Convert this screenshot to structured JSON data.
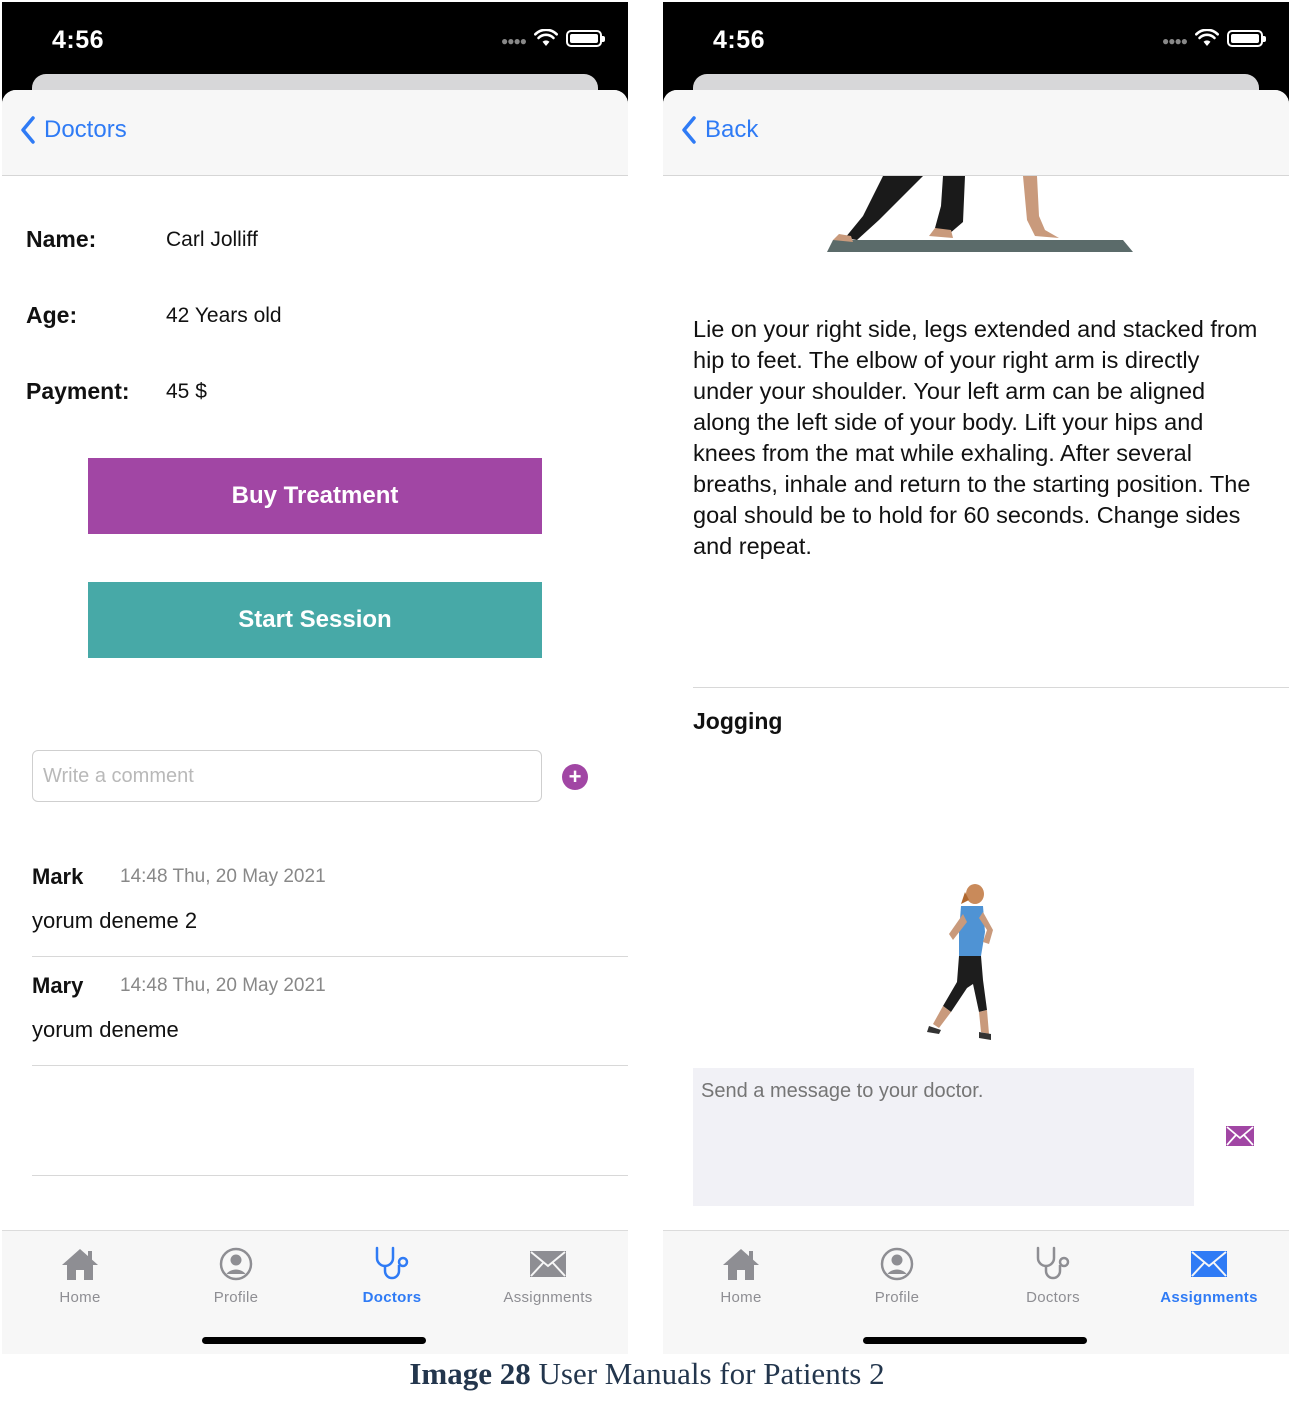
{
  "left_screen": {
    "status_time": "4:56",
    "nav_back_label": "Doctors",
    "fields": [
      {
        "label": "Name:",
        "value": "Carl Jolliff"
      },
      {
        "label": "Age:",
        "value": "42 Years old"
      },
      {
        "label": "Payment:",
        "value": "45 $"
      }
    ],
    "buy_button_label": "Buy Treatment",
    "start_button_label": "Start Session",
    "comment_placeholder": "Write a comment",
    "comments": [
      {
        "author": "Mark",
        "time": "14:48 Thu, 20 May 2021",
        "text": "yorum deneme 2"
      },
      {
        "author": "Mary",
        "time": "14:48 Thu, 20 May 2021",
        "text": "yorum deneme"
      }
    ],
    "active_tab": "Doctors"
  },
  "right_screen": {
    "status_time": "4:56",
    "nav_back_label": "Back",
    "exercise_description": "Lie on your right side, legs extended and stacked from hip to feet. The elbow of your right arm is directly under your shoulder. Your left arm can be aligned along the left side of your body. Lift your hips and knees from the mat while exhaling. After several breaths, inhale and return to the starting position. The goal should be to hold for 60 seconds. Change sides and repeat.",
    "section_title": "Jogging",
    "message_placeholder": "Send a message to your doctor.",
    "active_tab": "Assignments"
  },
  "tabs": [
    {
      "label": "Home",
      "icon": "home-icon"
    },
    {
      "label": "Profile",
      "icon": "profile-icon"
    },
    {
      "label": "Doctors",
      "icon": "stethoscope-icon"
    },
    {
      "label": "Assignments",
      "icon": "envelope-icon"
    }
  ],
  "colors": {
    "accent_blue": "#2f7bf5",
    "buy_button": "#a146a4",
    "start_button": "#47a9a7",
    "tab_inactive": "#8e8e93"
  },
  "caption": {
    "prefix": "Image 28",
    "text": " User Manuals for Patients 2"
  }
}
